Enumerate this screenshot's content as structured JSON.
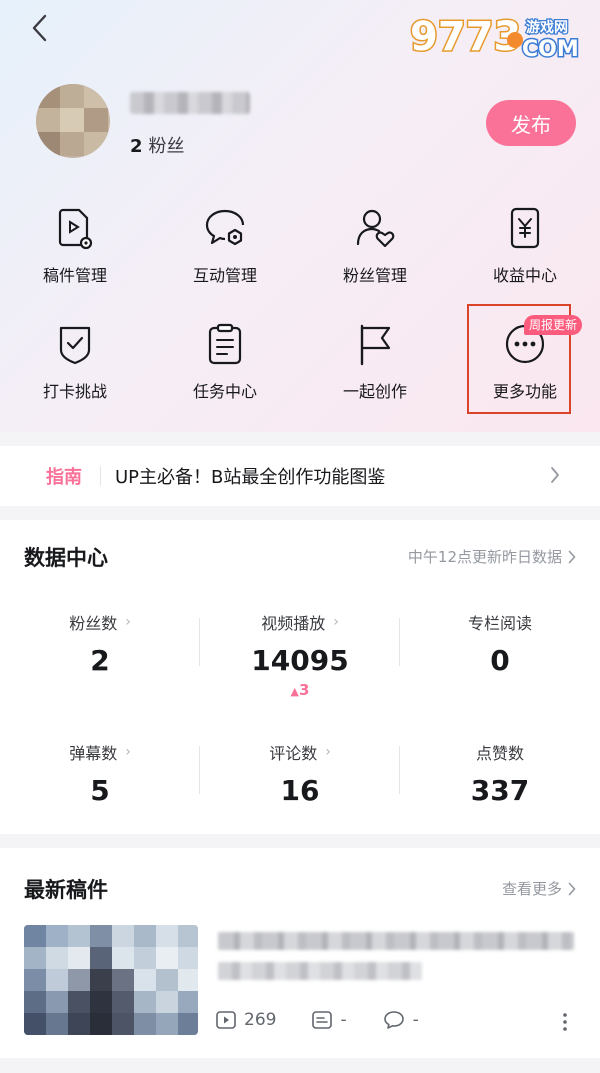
{
  "nav": {
    "back_icon": "chevron-left-icon"
  },
  "watermark": {
    "brand": "9773",
    "site_cn": "游戏网",
    "site_en": "COM"
  },
  "profile": {
    "fans_count": "2",
    "fans_label": "粉丝",
    "publish_label": "发布"
  },
  "tools": [
    {
      "label": "稿件管理",
      "icon": "manuscript-icon"
    },
    {
      "label": "互动管理",
      "icon": "interaction-icon"
    },
    {
      "label": "粉丝管理",
      "icon": "fans-icon"
    },
    {
      "label": "收益中心",
      "icon": "income-icon"
    },
    {
      "label": "打卡挑战",
      "icon": "checkin-icon"
    },
    {
      "label": "任务中心",
      "icon": "task-icon"
    },
    {
      "label": "一起创作",
      "icon": "flag-icon"
    },
    {
      "label": "更多功能",
      "icon": "more-icon",
      "badge": "周报更新"
    }
  ],
  "guide": {
    "tag": "指南",
    "text": "UP主必备！B站最全创作功能图鉴"
  },
  "data_center": {
    "title": "数据中心",
    "update_note": "中午12点更新昨日数据",
    "stats": [
      {
        "label": "粉丝数",
        "value": "2",
        "has_arrow": true
      },
      {
        "label": "视频播放",
        "value": "14095",
        "delta": "3",
        "has_arrow": true
      },
      {
        "label": "专栏阅读",
        "value": "0",
        "has_arrow": false
      },
      {
        "label": "弹幕数",
        "value": "5",
        "has_arrow": true
      },
      {
        "label": "评论数",
        "value": "16",
        "has_arrow": true
      },
      {
        "label": "点赞数",
        "value": "337",
        "has_arrow": false
      }
    ]
  },
  "latest": {
    "title": "最新稿件",
    "see_more": "查看更多",
    "item": {
      "plays": "269",
      "danmaku": "-",
      "comments": "-"
    }
  },
  "colors": {
    "accent": "#fb7299",
    "highlight_box": "#d9442b",
    "badge": "#fb5c7d"
  }
}
